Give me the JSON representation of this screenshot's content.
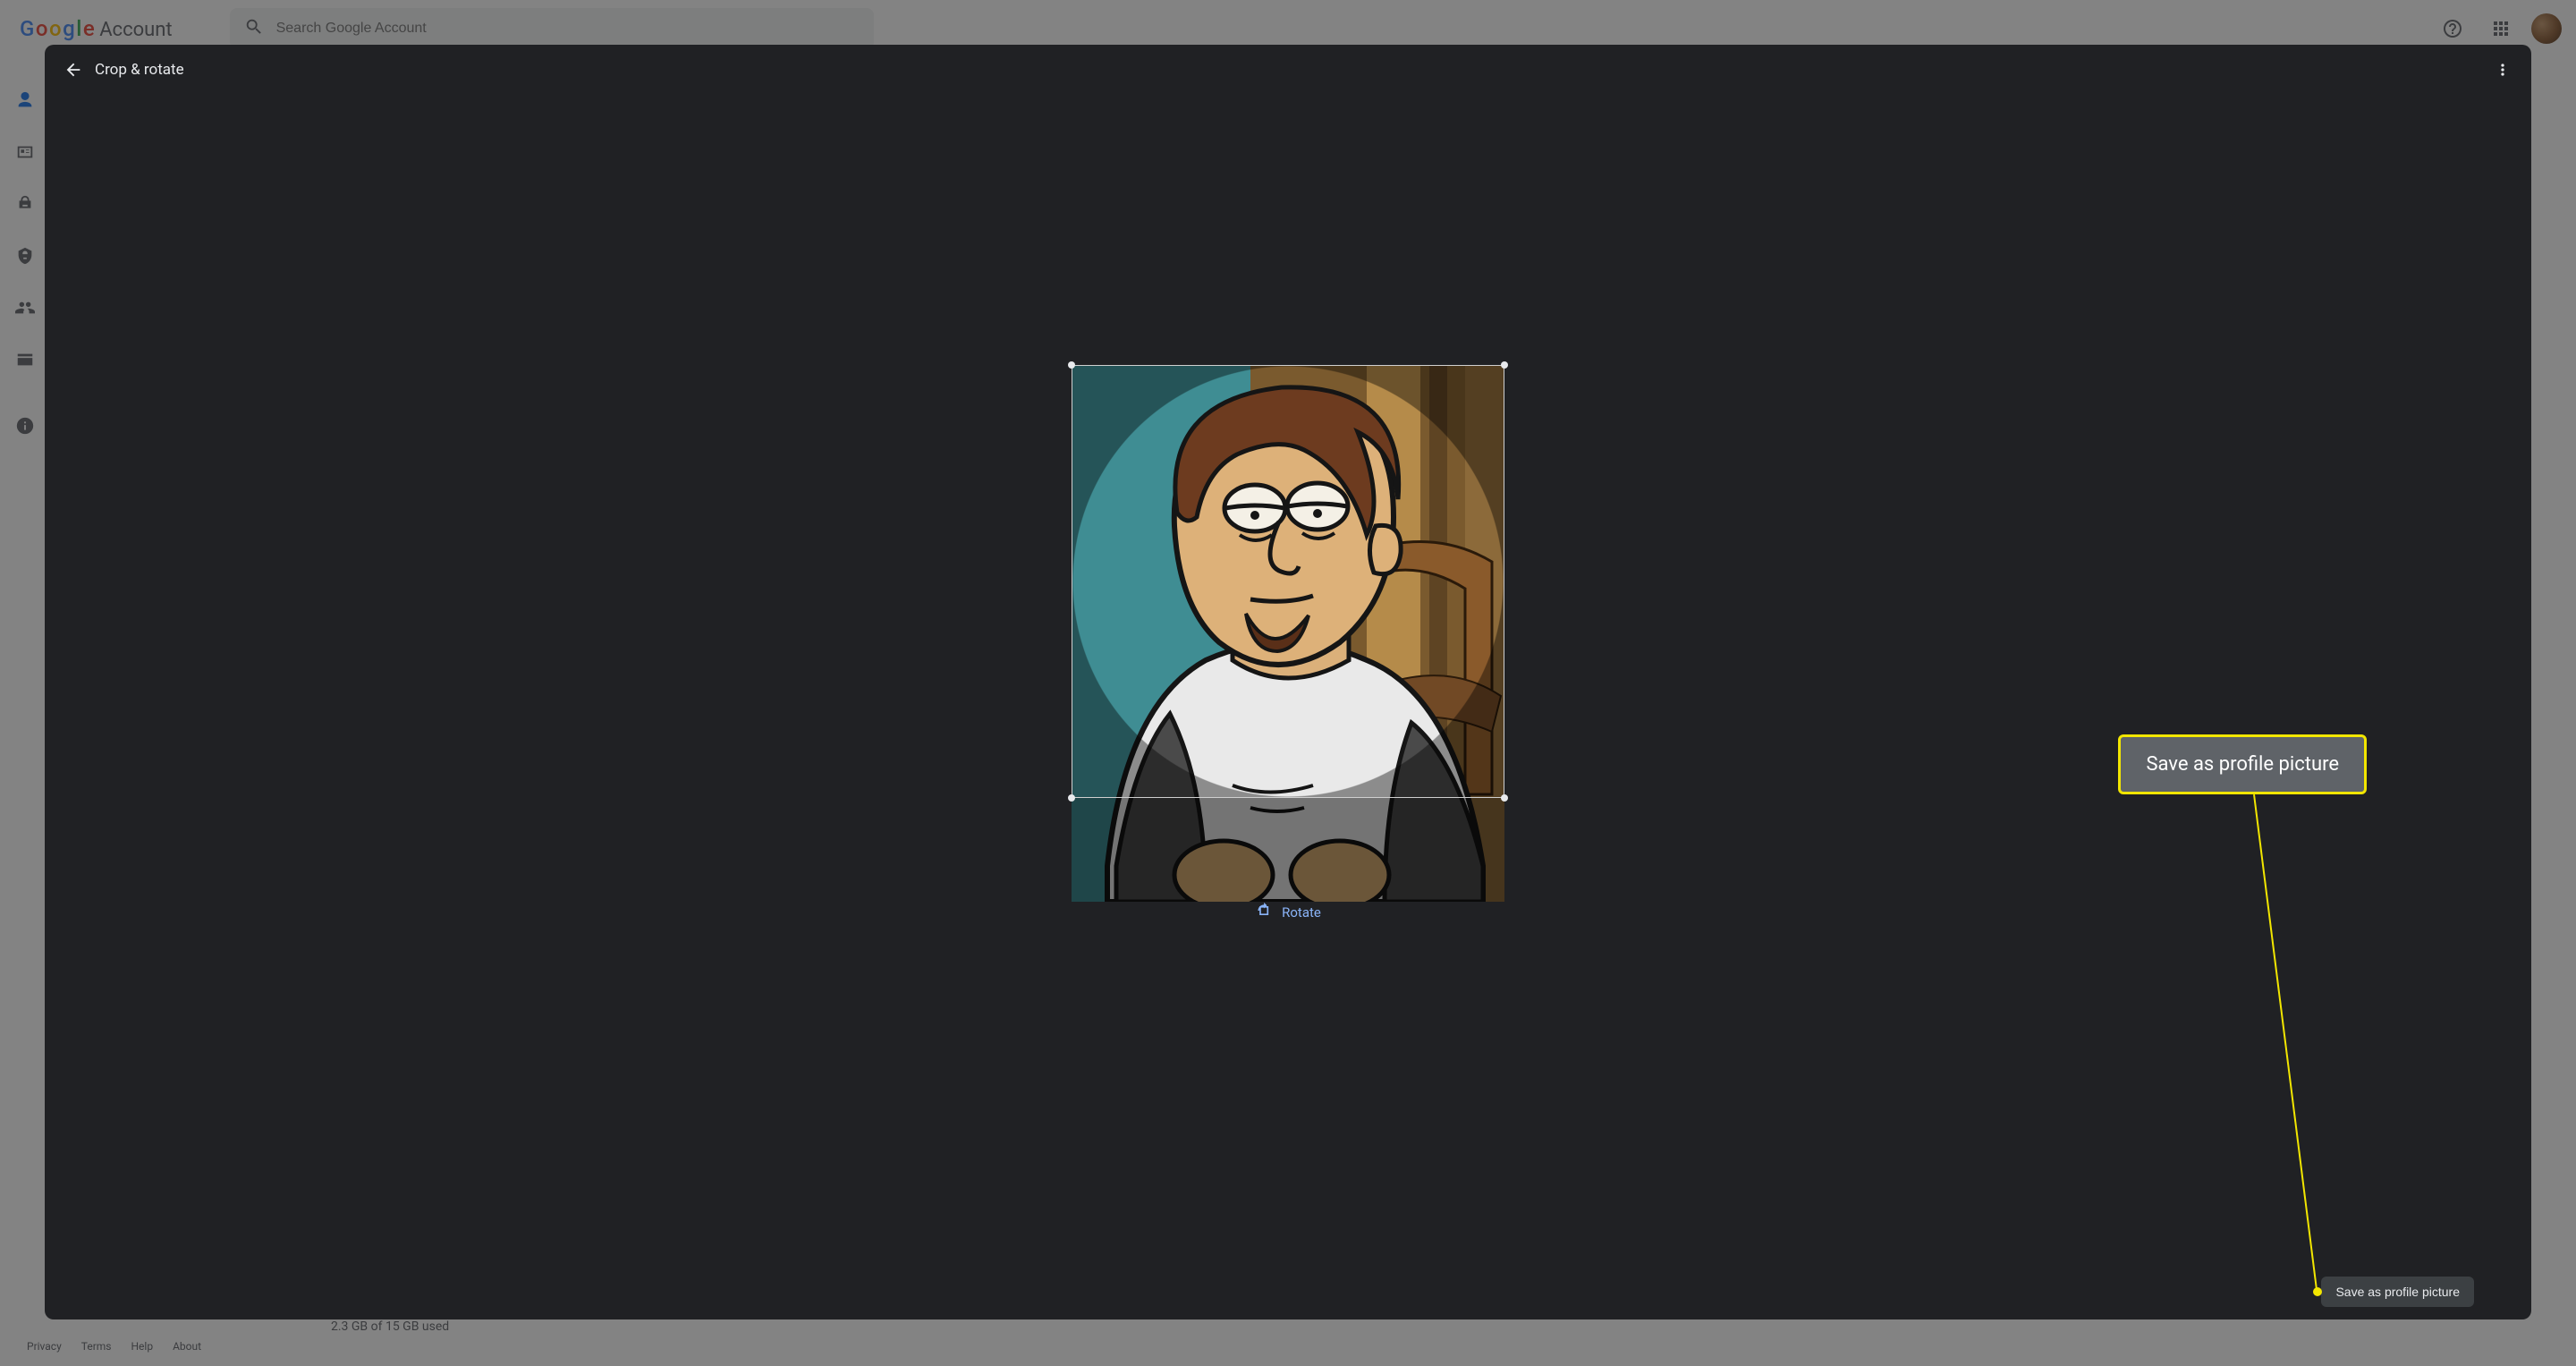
{
  "header": {
    "logo_google": "Google",
    "logo_account": " Account",
    "search_placeholder": "Search Google Account"
  },
  "footer": {
    "links": [
      "Privacy",
      "Terms",
      "Help",
      "About"
    ],
    "storage": "2.3 GB of 15 GB used"
  },
  "modal": {
    "title": "Crop & rotate",
    "rotate_label": "Rotate",
    "save_label": "Save as profile picture"
  },
  "annotation": {
    "label": "Save as profile picture"
  },
  "colors": {
    "google_blue": "#1a73e8",
    "google_red": "#ea4335",
    "google_yellow": "#fbbc04",
    "google_green": "#34a853",
    "modal_bg": "#202124",
    "accent_link": "#8ab4f8",
    "highlight": "#f2e600"
  }
}
